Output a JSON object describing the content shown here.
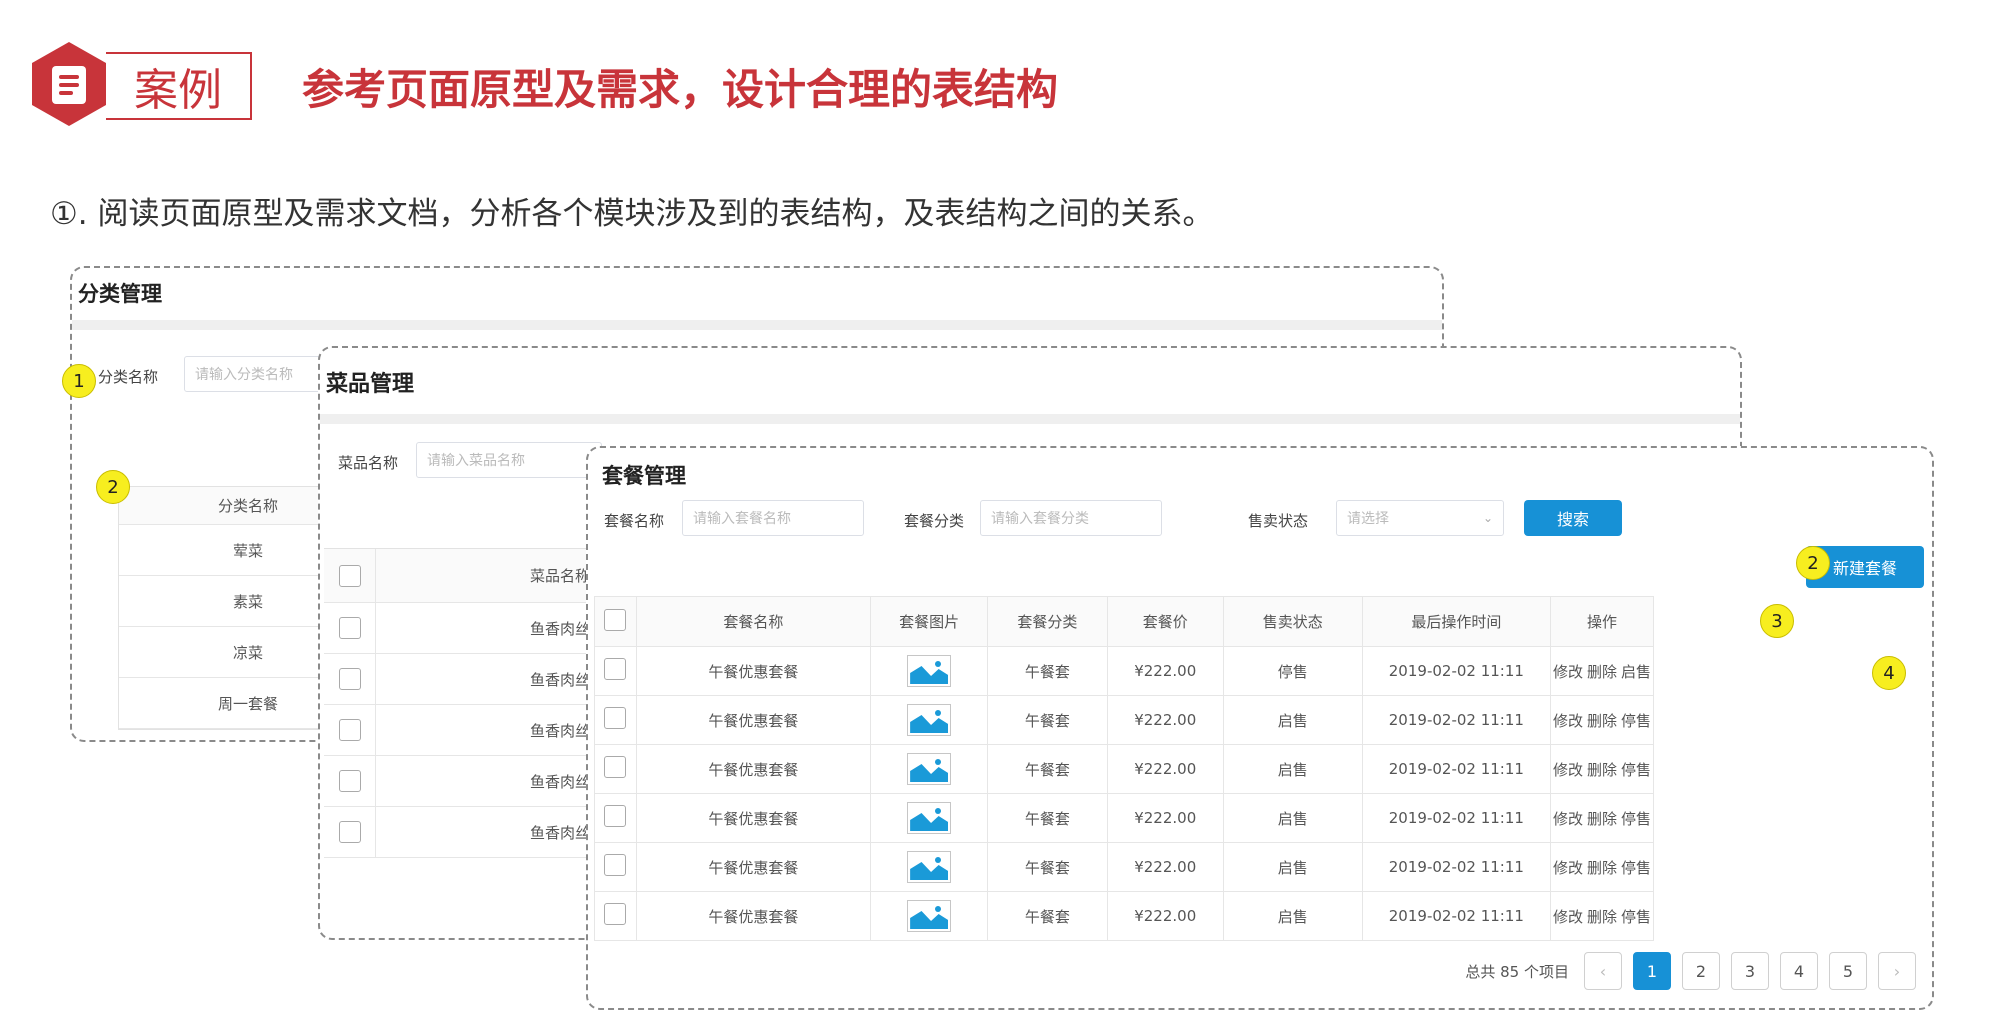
{
  "header": {
    "tag": "案例",
    "title": "参考页面原型及需求，设计合理的表结构",
    "step": "①. 阅读页面原型及需求文档，分析各个模块涉及到的表结构，及表结构之间的关系。"
  },
  "category_panel": {
    "title": "分类管理",
    "search_label": "分类名称",
    "search_placeholder": "请输入分类名称",
    "badges": [
      "1",
      "2"
    ],
    "column": "分类名称",
    "rows": [
      "荤菜",
      "素菜",
      "凉菜",
      "周一套餐"
    ]
  },
  "dish_panel": {
    "title": "菜品管理",
    "search_label": "菜品名称",
    "search_placeholder": "请输入菜品名称",
    "column": "菜品名称",
    "rows": [
      "鱼香肉丝",
      "鱼香肉丝",
      "鱼香肉丝",
      "鱼香肉丝",
      "鱼香肉丝"
    ]
  },
  "setmeal_panel": {
    "title": "套餐管理",
    "filters": {
      "name_label": "套餐名称",
      "name_placeholder": "请输入套餐名称",
      "category_label": "套餐分类",
      "category_placeholder": "请输入套餐分类",
      "status_label": "售卖状态",
      "status_placeholder": "请选择"
    },
    "search_button": "搜索",
    "new_button": "新建套餐",
    "badges": [
      "2",
      "3",
      "4"
    ],
    "columns": [
      "套餐名称",
      "套餐图片",
      "套餐分类",
      "套餐价",
      "售卖状态",
      "最后操作时间",
      "操作"
    ],
    "rows": [
      {
        "name": "午餐优惠套餐",
        "category": "午餐套",
        "price": "¥222.00",
        "status": "停售",
        "time": "2019-02-02 11:11",
        "op_edit": "修改",
        "op_delete": "删除",
        "op_toggle": "启售"
      },
      {
        "name": "午餐优惠套餐",
        "category": "午餐套",
        "price": "¥222.00",
        "status": "启售",
        "time": "2019-02-02 11:11",
        "op_edit": "修改",
        "op_delete": "删除",
        "op_toggle": "停售"
      },
      {
        "name": "午餐优惠套餐",
        "category": "午餐套",
        "price": "¥222.00",
        "status": "启售",
        "time": "2019-02-02 11:11",
        "op_edit": "修改",
        "op_delete": "删除",
        "op_toggle": "停售"
      },
      {
        "name": "午餐优惠套餐",
        "category": "午餐套",
        "price": "¥222.00",
        "status": "启售",
        "time": "2019-02-02 11:11",
        "op_edit": "修改",
        "op_delete": "删除",
        "op_toggle": "停售"
      },
      {
        "name": "午餐优惠套餐",
        "category": "午餐套",
        "price": "¥222.00",
        "status": "启售",
        "time": "2019-02-02 11:11",
        "op_edit": "修改",
        "op_delete": "删除",
        "op_toggle": "停售"
      },
      {
        "name": "午餐优惠套餐",
        "category": "午餐套",
        "price": "¥222.00",
        "status": "启售",
        "time": "2019-02-02 11:11",
        "op_edit": "修改",
        "op_delete": "删除",
        "op_toggle": "停售"
      }
    ],
    "pagination": {
      "total": "总共 85 个项目",
      "pages": [
        "1",
        "2",
        "3",
        "4",
        "5"
      ],
      "prev": "‹",
      "next": "›",
      "current": "1"
    }
  },
  "colors": {
    "brand_red": "#c8343a",
    "primary_blue": "#1791d6",
    "badge_yellow": "#f7ee1f"
  }
}
